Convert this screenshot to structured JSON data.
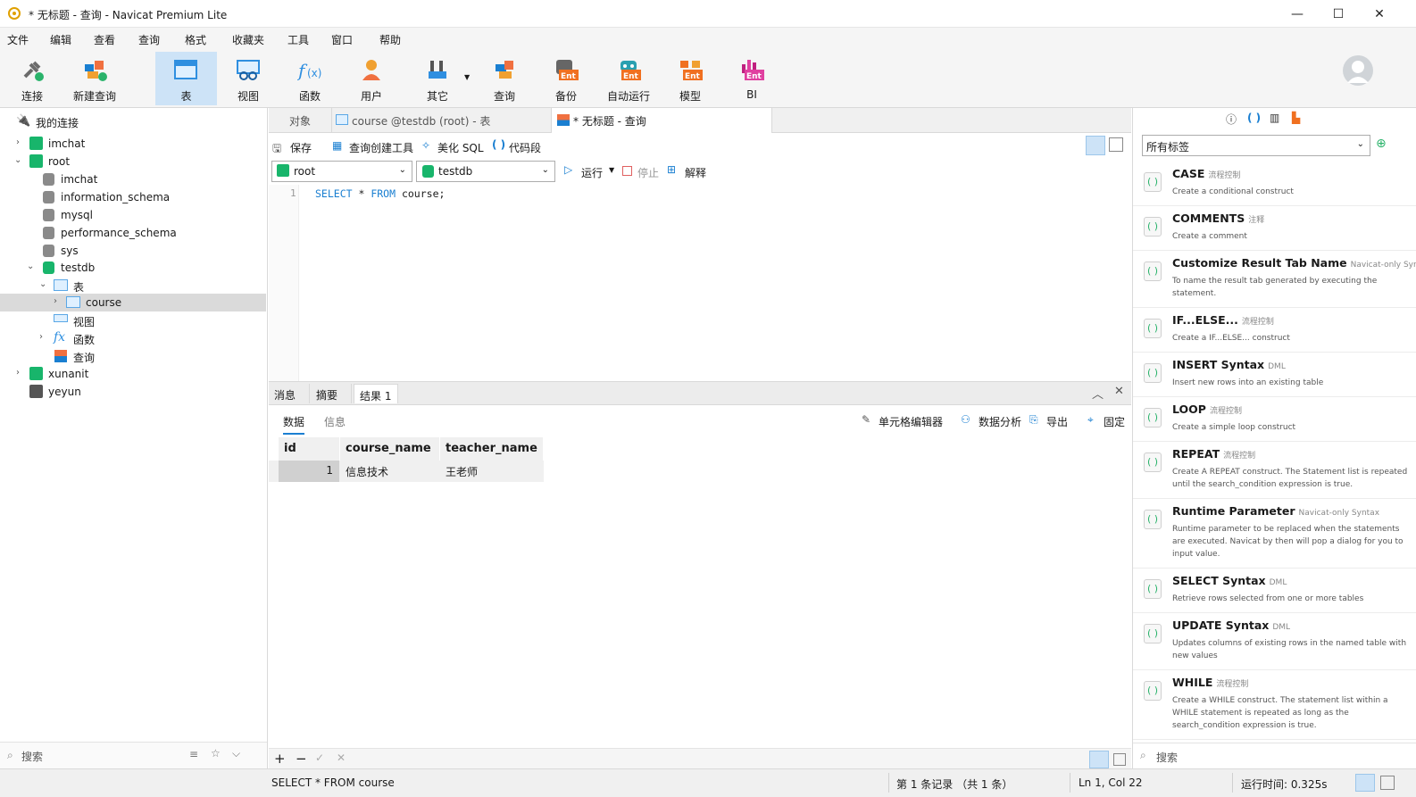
{
  "window": {
    "title": "* 无标题 - 查询 - Navicat Premium Lite",
    "min": "—",
    "max": "☐",
    "close": "✕"
  },
  "menu": [
    "文件",
    "编辑",
    "查看",
    "查询",
    "格式",
    "收藏夹",
    "工具",
    "窗口",
    "帮助"
  ],
  "toolbar": [
    {
      "label": "连接",
      "icon": "plug-icon"
    },
    {
      "label": "新建查询",
      "icon": "new-query-icon"
    },
    {
      "label": "表",
      "icon": "table-icon",
      "active": true
    },
    {
      "label": "视图",
      "icon": "view-icon"
    },
    {
      "label": "函数",
      "icon": "function-icon"
    },
    {
      "label": "用户",
      "icon": "user-icon"
    },
    {
      "label": "其它",
      "icon": "tools-icon"
    },
    {
      "label": "查询",
      "icon": "query-icon"
    },
    {
      "label": "备份",
      "icon": "backup-icon",
      "badge": "Ent"
    },
    {
      "label": "自动运行",
      "icon": "robot-icon",
      "badge": "Ent"
    },
    {
      "label": "模型",
      "icon": "model-icon",
      "badge": "Ent"
    },
    {
      "label": "BI",
      "icon": "bi-icon",
      "badge": "Ent"
    }
  ],
  "tree": {
    "header": "我的连接",
    "rows": [
      "imchat",
      "root",
      "imchat",
      "information_schema",
      "mysql",
      "performance_schema",
      "sys",
      "testdb",
      "表",
      "course",
      "视图",
      "函数",
      "查询",
      "xunanit",
      "yeyun"
    ],
    "search": "搜索"
  },
  "tabs": {
    "objects": "对象",
    "course": "course @testdb (root) - 表",
    "query": "* 无标题 - 查询"
  },
  "querybar": {
    "save": "保存",
    "builder": "查询创建工具",
    "beautify": "美化 SQL",
    "snippet": "代码段",
    "conn": "root",
    "db": "testdb",
    "run": "运行",
    "stop": "停止",
    "explain": "解释"
  },
  "editor": {
    "line": "1",
    "sql_kw1": "SELECT",
    "sql_mid": " * ",
    "sql_kw2": "FROM",
    "sql_end": " course;"
  },
  "results": {
    "tabs": [
      "消息",
      "摘要",
      "结果 1"
    ],
    "subtabs": [
      "数据",
      "信息"
    ],
    "actions": [
      "单元格编辑器",
      "数据分析",
      "导出",
      "固定"
    ],
    "columns": [
      "id",
      "course_name",
      "teacher_name"
    ],
    "rows": [
      [
        "1",
        "信息技术",
        "王老师"
      ]
    ]
  },
  "snippets": {
    "filter": "所有标签",
    "items": [
      {
        "name": "CASE",
        "tag": "流程控制",
        "desc": "Create a conditional construct"
      },
      {
        "name": "COMMENTS",
        "tag": "注释",
        "desc": "Create a comment"
      },
      {
        "name": "Customize Result Tab Name",
        "tag": "Navicat-only Syntax",
        "desc": "To name the result tab generated by executing the statement."
      },
      {
        "name": "IF...ELSE...",
        "tag": "流程控制",
        "desc": "Create a IF...ELSE... construct"
      },
      {
        "name": "INSERT Syntax",
        "tag": "DML",
        "desc": "Insert new rows into an existing table"
      },
      {
        "name": "LOOP",
        "tag": "流程控制",
        "desc": "Create a simple loop construct"
      },
      {
        "name": "REPEAT",
        "tag": "流程控制",
        "desc": "Create A REPEAT construct. The Statement list is repeated until the search_condition expression is true."
      },
      {
        "name": "Runtime Parameter",
        "tag": "Navicat-only Syntax",
        "desc": "Runtime parameter to be replaced when the statements are executed. Navicat by then will pop a dialog for you to input value."
      },
      {
        "name": "SELECT Syntax",
        "tag": "DML",
        "desc": "Retrieve rows selected from one or more tables"
      },
      {
        "name": "UPDATE Syntax",
        "tag": "DML",
        "desc": "Updates columns of existing rows in the named table with new values"
      },
      {
        "name": "WHILE",
        "tag": "流程控制",
        "desc": "Create a WHILE construct. The statement list within a WHILE statement is repeated as long as the search_condition expression is true."
      }
    ],
    "search": "搜索"
  },
  "status": {
    "sql": "SELECT * FROM course",
    "records": "第 1 条记录 （共 1 条）",
    "pos": "Ln 1, Col 22",
    "time": "运行时间: 0.325s"
  }
}
